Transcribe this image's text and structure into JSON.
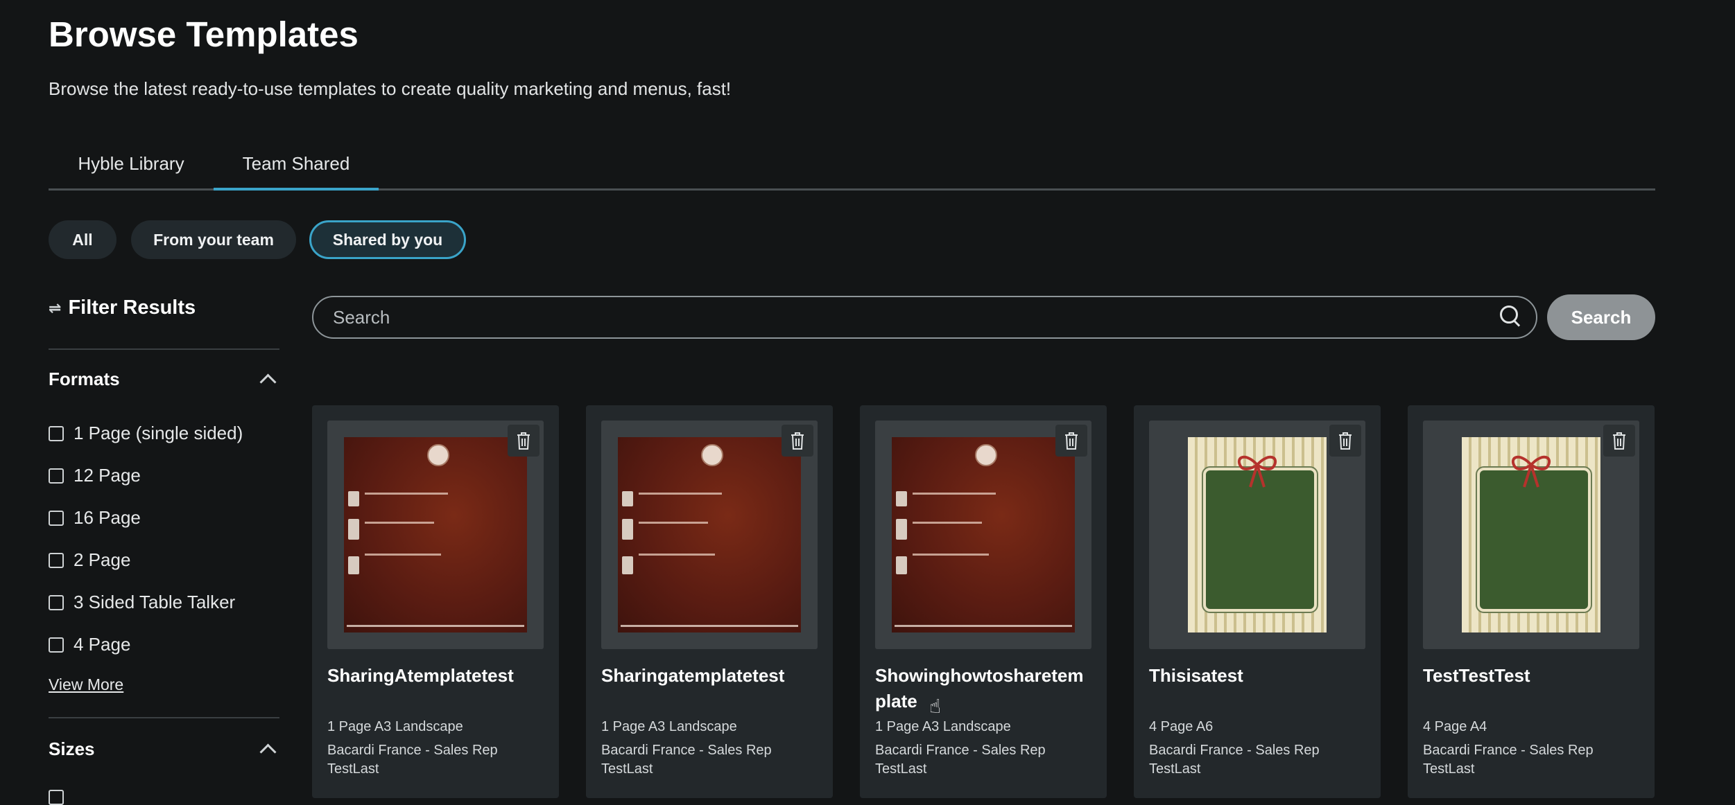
{
  "page": {
    "title": "Browse Templates",
    "subtitle": "Browse the latest ready-to-use templates to create quality marketing and menus, fast!"
  },
  "tabs": [
    {
      "label": "Hyble Library",
      "active": false
    },
    {
      "label": "Team Shared",
      "active": true
    }
  ],
  "chips": [
    {
      "label": "All",
      "selected": false
    },
    {
      "label": "From your team",
      "selected": false
    },
    {
      "label": "Shared by you",
      "selected": true
    }
  ],
  "filters": {
    "title": "Filter Results",
    "icon": "sliders-icon",
    "formats": {
      "label": "Formats",
      "options": [
        "1 Page (single sided)",
        "12 Page",
        "16 Page",
        "2 Page",
        "3 Sided Table Talker",
        "4 Page"
      ],
      "view_more": "View More"
    },
    "sizes": {
      "label": "Sizes"
    }
  },
  "search": {
    "placeholder": "Search",
    "button_label": "Search"
  },
  "cards": [
    {
      "title": "SharingAtemplatetest",
      "format": "1 Page A3 Landscape",
      "author": "Bacardi France - Sales Rep TestLast",
      "art": "menu"
    },
    {
      "title": "Sharingatemplatetest",
      "format": "1 Page A3 Landscape",
      "author": "Bacardi France - Sales Rep TestLast",
      "art": "menu"
    },
    {
      "title": "Showinghowtosharetemplate",
      "format": "1 Page A3 Landscape",
      "author": "Bacardi France - Sales Rep TestLast",
      "art": "menu"
    },
    {
      "title": "Thisisatest",
      "format": "4 Page A6",
      "author": "Bacardi France - Sales Rep TestLast",
      "art": "xmas"
    },
    {
      "title": "TestTestTest",
      "format": "4 Page A4",
      "author": "Bacardi France - Sales Rep TestLast",
      "art": "xmas"
    }
  ],
  "colors": {
    "background": "#131516",
    "accent": "#3aa4c9",
    "card": "#23282b"
  }
}
